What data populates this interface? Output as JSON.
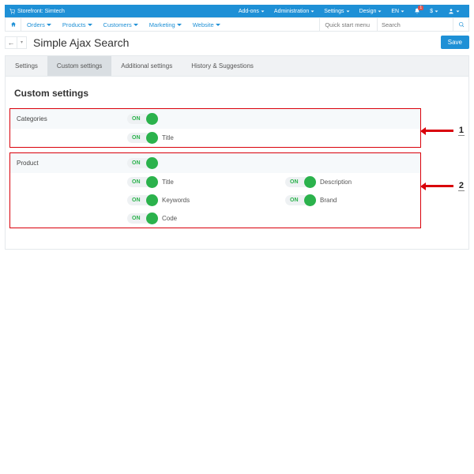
{
  "topbar": {
    "storefront_label": "Storefront: Simtech",
    "items": [
      {
        "label": "Add-ons"
      },
      {
        "label": "Administration"
      },
      {
        "label": "Settings"
      },
      {
        "label": "Design"
      },
      {
        "label": "EN"
      }
    ],
    "currency": "$",
    "notification_count": "1"
  },
  "navbar": {
    "items": [
      {
        "label": "Orders"
      },
      {
        "label": "Products"
      },
      {
        "label": "Customers"
      },
      {
        "label": "Marketing"
      },
      {
        "label": "Website"
      }
    ],
    "quick_start_label": "Quick start menu",
    "search_placeholder": "Search"
  },
  "title": {
    "page": "Simple Ajax Search",
    "save": "Save"
  },
  "tabs": [
    {
      "label": "Settings",
      "active": false
    },
    {
      "label": "Custom settings",
      "active": true
    },
    {
      "label": "Additional settings",
      "active": false
    },
    {
      "label": "History & Suggestions",
      "active": false
    }
  ],
  "section_title": "Custom settings",
  "toggle_on": "ON",
  "groups": {
    "categories": {
      "name": "Categories",
      "fields": {
        "title": "Title"
      }
    },
    "product": {
      "name": "Product",
      "fields": {
        "title": "Title",
        "description": "Description",
        "keywords": "Keywords",
        "brand": "Brand",
        "code": "Code"
      }
    }
  },
  "annotations": {
    "one": "1",
    "two": "2"
  }
}
